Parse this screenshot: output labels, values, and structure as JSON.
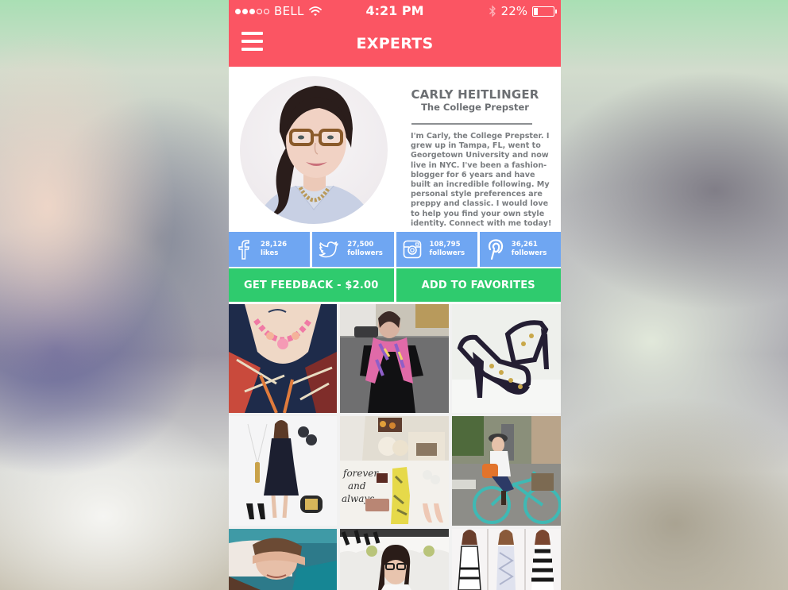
{
  "status_bar": {
    "signal_filled": 3,
    "signal_total": 5,
    "carrier": "BELL",
    "wifi_icon": "wifi-icon",
    "time": "4:21 PM",
    "bluetooth_icon": "bluetooth-icon",
    "battery_percent": "22%",
    "battery_level": 0.22
  },
  "nav": {
    "menu_icon": "hamburger-menu-icon",
    "title": "EXPERTS",
    "background_color": "#fb5563"
  },
  "profile": {
    "avatar_alt": "Carly Heitlinger portrait",
    "name": "CARLY HEITLINGER",
    "subtitle": "The College Prepster",
    "bio": "I'm Carly, the College Prepster. I grew up in Tampa, FL, went to Georgetown University and now live in NYC.  I've been a fashion-blogger for 6 years and have built an incredible following. My personal style preferences are preppy and classic. I would love to help you find your own style identity.  Connect with me today!"
  },
  "social": {
    "color": "#6fa6f2",
    "items": [
      {
        "network": "facebook",
        "icon": "facebook-icon",
        "count": "28,126",
        "unit": "likes"
      },
      {
        "network": "twitter",
        "icon": "twitter-icon",
        "count": "27,500",
        "unit": "followers"
      },
      {
        "network": "instagram",
        "icon": "instagram-icon",
        "count": "108,795",
        "unit": "followers"
      },
      {
        "network": "pinterest",
        "icon": "pinterest-icon",
        "count": "36,261",
        "unit": "followers"
      }
    ]
  },
  "actions": {
    "color": "#2fcb6e",
    "get_feedback": "GET FEEDBACK - $2.00",
    "add_favorites": "ADD TO FAVORITES"
  },
  "gallery": {
    "photos": [
      {
        "alt": "Pink statement necklace with tribal print top"
      },
      {
        "alt": "Woman in black dress with pink floral scarf on street"
      },
      {
        "alt": "Black studded strappy sandals"
      },
      {
        "alt": "Navy dress outfit with gold pendant, earrings, sandals and ring"
      },
      {
        "alt": "Forever and always collage with roses and yellow floral dress"
      },
      {
        "alt": "Woman in hat riding teal bicycle with orange bag"
      },
      {
        "alt": "Woman covering eyes lying on pillow"
      },
      {
        "alt": "Woman with glasses at white dessert table"
      },
      {
        "alt": "Three models in black and white dresses"
      }
    ]
  }
}
